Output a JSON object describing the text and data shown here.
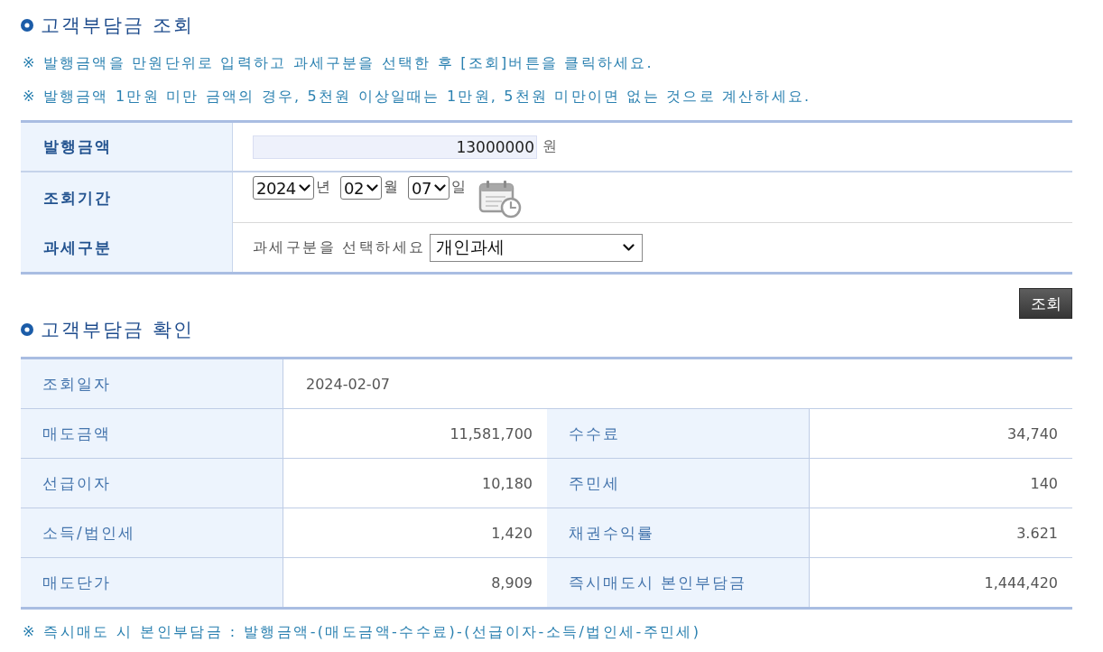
{
  "query": {
    "title": "고객부담금 조회",
    "notes": [
      "※ 발행금액을 만원단위로 입력하고 과세구분을 선택한 후 [조회]버튼을 클릭하세요.",
      "※ 발행금액 1만원 미만 금액의 경우, 5천원 이상일때는 1만원, 5천원 미만이면 없는 것으로 계산하세요."
    ],
    "form": [
      {
        "kind": "amount",
        "label": "발행금액",
        "value": "13000000",
        "unit": "원"
      },
      {
        "kind": "date",
        "label": "조회기간",
        "parts": [
          {
            "value": "2024",
            "unit": "년"
          },
          {
            "value": "02",
            "unit": "월"
          },
          {
            "value": "07",
            "unit": "일"
          }
        ]
      },
      {
        "kind": "select",
        "label": "과세구분",
        "prompt": "과세구분을 선택하세요",
        "value": "개인과세"
      }
    ],
    "submit_button": "조회"
  },
  "result": {
    "title": "고객부담금 확인",
    "date": {
      "label": "조회일자",
      "value": "2024-02-07"
    },
    "rows": [
      {
        "cells": [
          {
            "label": "매도금액",
            "value": "11,581,700"
          },
          {
            "label": "수수료",
            "value": "34,740"
          }
        ]
      },
      {
        "cells": [
          {
            "label": "선급이자",
            "value": "10,180"
          },
          {
            "label": "주민세",
            "value": "140"
          }
        ]
      },
      {
        "cells": [
          {
            "label": "소득/법인세",
            "value": "1,420"
          },
          {
            "label": "채권수익률",
            "value": "3.621"
          }
        ]
      },
      {
        "cells": [
          {
            "label": "매도단가",
            "value": "8,909"
          },
          {
            "label": "즉시매도시 본인부담금",
            "value": "1,444,420"
          }
        ]
      }
    ],
    "footnote": "※ 즉시매도 시 본인부담금 : 발행금액-(매도금액-수수료)-(선급이자-소득/법인세-주민세)"
  }
}
